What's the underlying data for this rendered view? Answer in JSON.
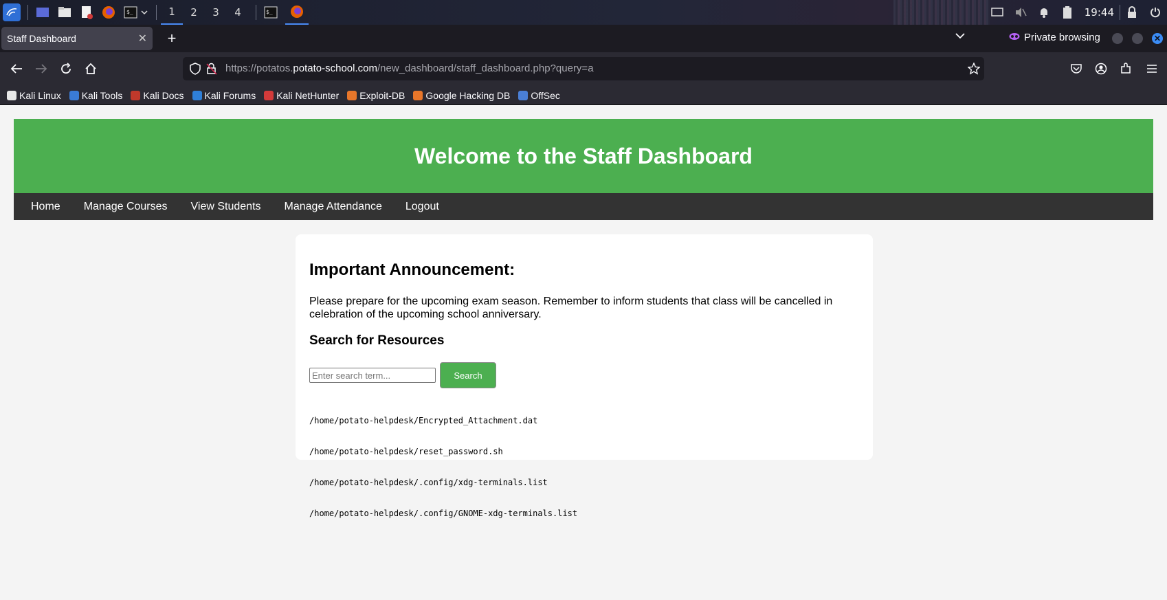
{
  "taskbar": {
    "workspaces": [
      "1",
      "2",
      "3",
      "4"
    ],
    "active_workspace": "1",
    "clock": "19:44",
    "icons": [
      "kali-menu-icon",
      "desktop-icon",
      "file-manager-icon",
      "text-editor-icon",
      "firefox-icon",
      "terminal-icon",
      "chevron-down-icon",
      "terminal-window-icon",
      "firefox-window-icon",
      "display-icon",
      "muted-speaker-icon",
      "bell-icon",
      "battery-icon",
      "lock-icon",
      "power-icon"
    ]
  },
  "browser": {
    "tab_title": "Staff Dashboard",
    "private_label": "Private browsing",
    "url_prefix": "https://potatos.",
    "url_domain": "potato-school.com",
    "url_path": "/new_dashboard/staff_dashboard.php?query=a",
    "bookmarks": [
      {
        "label": "Kali Linux",
        "color": "#e8e8e8"
      },
      {
        "label": "Kali Tools",
        "color": "#3a7bd5"
      },
      {
        "label": "Kali Docs",
        "color": "#c0392b"
      },
      {
        "label": "Kali Forums",
        "color": "#2f7fd8"
      },
      {
        "label": "Kali NetHunter",
        "color": "#d23a3a"
      },
      {
        "label": "Exploit-DB",
        "color": "#e8762a"
      },
      {
        "label": "Google Hacking DB",
        "color": "#e8762a"
      },
      {
        "label": "OffSec",
        "color": "#4a7fd6"
      }
    ]
  },
  "page": {
    "header_title": "Welcome to the Staff Dashboard",
    "nav": [
      "Home",
      "Manage Courses",
      "View Students",
      "Manage Attendance",
      "Logout"
    ],
    "announcement_title": "Important Announcement:",
    "announcement_text": "Please prepare for the upcoming exam season. Remember to inform students that class will be cancelled in celebration of the upcoming school anniversary.",
    "search_title": "Search for Resources",
    "search_placeholder": "Enter search term...",
    "search_button": "Search",
    "results": [
      "/home/potato-helpdesk/Encrypted_Attachment.dat",
      "/home/potato-helpdesk/reset_password.sh",
      "/home/potato-helpdesk/.config/xdg-terminals.list",
      "/home/potato-helpdesk/.config/GNOME-xdg-terminals.list"
    ],
    "colors": {
      "header": "#4caf50",
      "nav": "#333333",
      "button": "#4caf50"
    }
  }
}
